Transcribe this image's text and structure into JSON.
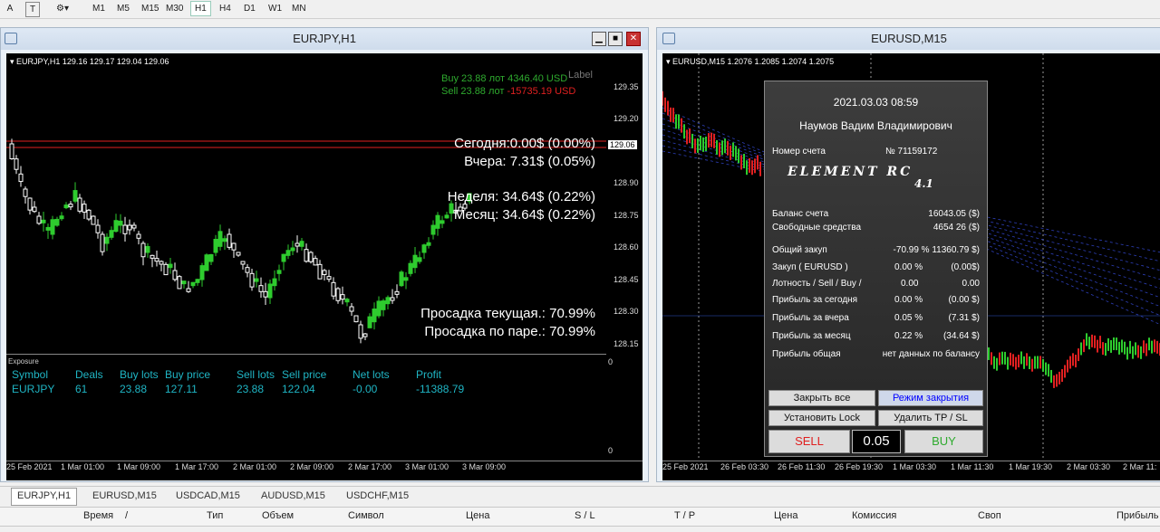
{
  "toolbar": {
    "tools": [
      "A",
      "T",
      "⚙▾"
    ],
    "timeframes": [
      "M1",
      "M5",
      "M15",
      "M30",
      "H1",
      "H4",
      "D1",
      "W1",
      "MN"
    ],
    "active_timeframe": "H1"
  },
  "left_window": {
    "title": "EURJPY,H1",
    "symbol_header": "▾ EURJPY,H1  129.16 129.17 129.04 129.06",
    "label_text": "Label",
    "buy_line": "Buy 23.88 лот   4346.40 USD",
    "sell_line_a": "Sell 23.88 лот ",
    "sell_line_b": "-15735.19 USD",
    "stats": {
      "today": "Сегодня:0.00$  (0.00%)",
      "yesterday": "Вчера:  7.31$  (0.05%)",
      "week": "Неделя:  34.64$  (0.22%)",
      "month": "Месяц:  34.64$  (0.22%)",
      "drawdown_current": "Просадка текущая.:  70.99%",
      "drawdown_pair": "Просадка по паре.:  70.99%"
    },
    "y_ticks": [
      "129.35",
      "129.20",
      "128.90",
      "128.75",
      "128.60",
      "128.45",
      "128.30",
      "128.15"
    ],
    "current_price": "129.06",
    "x_ticks": [
      "25 Feb 2021",
      "1 Mar 01:00",
      "1 Mar 09:00",
      "1 Mar 17:00",
      "2 Mar 01:00",
      "2 Mar 09:00",
      "2 Mar 17:00",
      "3 Mar 01:00",
      "3 Mar 09:00"
    ],
    "exposure": {
      "label": "Exposure",
      "headers": [
        "Symbol",
        "Deals",
        "Buy lots",
        "Buy price",
        "Sell lots",
        "Sell price",
        "Net lots",
        "Profit"
      ],
      "row": [
        "EURJPY",
        "61",
        "23.88",
        "127.11",
        "23.88",
        "122.04",
        "-0.00",
        "-11388.79"
      ],
      "y_top": "0",
      "y_bottom": "0"
    }
  },
  "right_window": {
    "title": "EURUSD,M15",
    "symbol_header": "▾ EURUSD,M15  1.2076 1.2085 1.2074 1.2075",
    "x_ticks": [
      "25 Feb 2021",
      "26 Feb 03:30",
      "26 Feb 11:30",
      "26 Feb 19:30",
      "1 Mar 03:30",
      "1 Mar 11:30",
      "1 Mar 19:30",
      "2 Mar 03:30",
      "2 Mar 11:"
    ]
  },
  "panel": {
    "datetime": "2021.03.03 08:59",
    "owner": "Наумов Вадим Владимирович",
    "account_label": "Номер счета",
    "account_value": "№ 71159172",
    "logo": "ELEMENT RC",
    "version": "4.1",
    "rows": [
      {
        "label": "Баланс счета",
        "value": "16043.05 ($)"
      },
      {
        "label": "Свободные средства",
        "value": "4654 26 ($)"
      },
      {
        "label": "Общий закуп",
        "value": "-70.99 % 11360.79 $)"
      },
      {
        "label": "Закуп  ( EURUSD )",
        "v1": "0.00 %",
        "v2": "(0.00$)"
      },
      {
        "label": "Лотность  / Sell / Buy /",
        "v1": "0.00",
        "v2": "0.00"
      },
      {
        "label": "Прибыль за сегодня",
        "v1": "0.00 %",
        "v2": "(0.00 $)"
      },
      {
        "label": "Прибыль за вчера",
        "v1": "0.05 %",
        "v2": "(7.31 $)"
      },
      {
        "label": "Прибыль за месяц",
        "v1": "0.22 %",
        "v2": "(34.64 $)"
      },
      {
        "label": "Прибыль общая",
        "value": "нет данных по балансу"
      }
    ],
    "buttons": {
      "close_all": "Закрыть все",
      "close_mode": "Режим закрытия",
      "set_lock": "Установить Lock",
      "delete_tpsl": "Удалить TP / SL",
      "sell": "SELL",
      "lot": "0.05",
      "buy": "BUY"
    }
  },
  "tabs": [
    "EURJPY,H1",
    "EURUSD,M15",
    "USDCAD,M15",
    "AUDUSD,M15",
    "USDCHF,M15"
  ],
  "active_tab": "EURJPY,H1",
  "table_headers": [
    "Время",
    "/",
    "Тип",
    "Объем",
    "Символ",
    "Цена",
    "S / L",
    "T / P",
    "Цена",
    "Комиссия",
    "Своп",
    "Прибыль"
  ],
  "colors": {
    "bull": "#2ecc2e",
    "bear": "#ffffff",
    "buy": "#2eaa2e",
    "sell": "#e02020",
    "accent_blue": "#0000ff",
    "exposure_text": "#1fb5c4"
  }
}
